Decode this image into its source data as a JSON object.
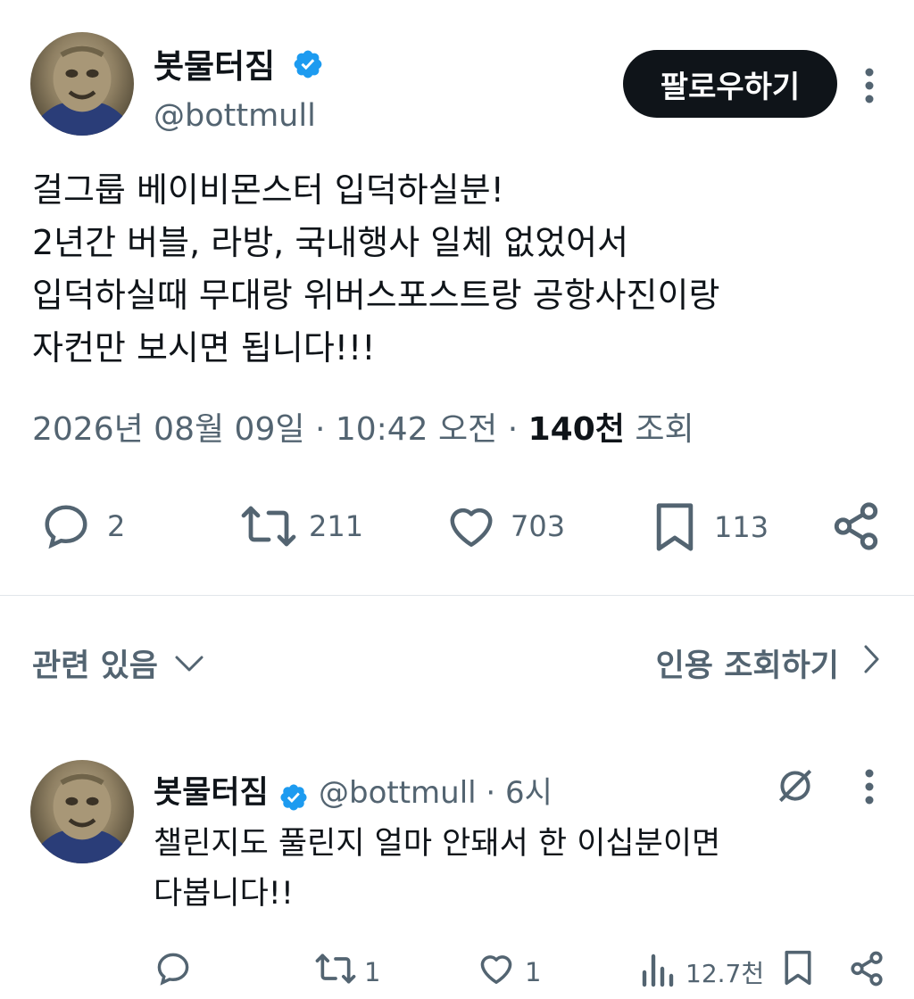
{
  "tweet": {
    "author_name": "봇물터짐",
    "author_handle": "@bottmull",
    "follow_label": "팔로우하기",
    "text_lines": [
      "걸그룹 베이비몬스터 입덕하실분!",
      "2년간 버블, 라방, 국내행사 일체 없었어서",
      "입덕하실때 무대랑 위버스포스트랑 공항사진이랑",
      "자컨만 보시면 됩니다!!!"
    ],
    "date": "2026년 08월 09일",
    "time": "10:42 오전",
    "views_count": "140천",
    "views_label": "조회",
    "stats": {
      "replies": "2",
      "retweets": "211",
      "likes": "703",
      "bookmarks": "113"
    }
  },
  "related": {
    "label": "관련 있음",
    "quotes_label": "인용 조회하기"
  },
  "reply": {
    "author_name": "봇물터짐",
    "handle_time": "@bottmull · 6시",
    "text_lines": [
      "챌린지도 풀린지 얼마 안돼서 한 이십분이면",
      "다봅니다!!"
    ],
    "stats": {
      "retweets": "1",
      "likes": "1",
      "views": "12.7천"
    }
  },
  "colors": {
    "verified": "#1d9bf0",
    "text_primary": "#0f1419",
    "text_secondary": "#536471",
    "button_bg": "#0f1419"
  }
}
